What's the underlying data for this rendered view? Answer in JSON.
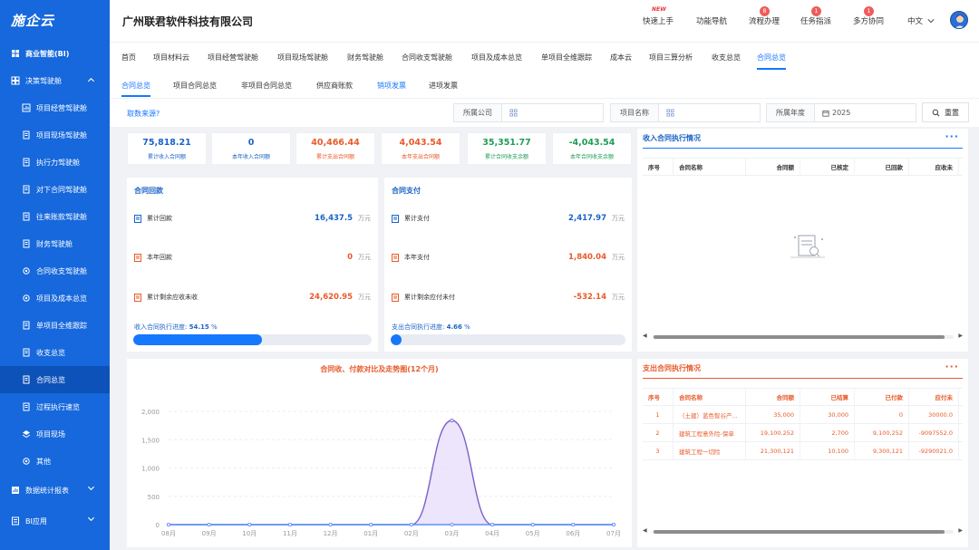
{
  "brand": {
    "logo": "施企云"
  },
  "sidebar": {
    "top": {
      "label": "商业智能(BI)",
      "icon": "grid-icon"
    },
    "group": {
      "label": "决策驾驶舱",
      "icon": "dashboard-icon"
    },
    "items": [
      {
        "label": "项目经营驾驶舱",
        "icon": "chart-icon"
      },
      {
        "label": "项目现场驾驶舱",
        "icon": "document-icon"
      },
      {
        "label": "执行力驾驶舱",
        "icon": "document-icon"
      },
      {
        "label": "对下合同驾驶舱",
        "icon": "document-icon"
      },
      {
        "label": "往来账款驾驶舱",
        "icon": "document-icon"
      },
      {
        "label": "财务驾驶舱",
        "icon": "document-icon"
      },
      {
        "label": "合同收支驾驶舱",
        "icon": "gear-icon"
      },
      {
        "label": "项目及成本总览",
        "icon": "gear-icon"
      },
      {
        "label": "单项目全维跟踪",
        "icon": "document-icon"
      },
      {
        "label": "收支总览",
        "icon": "document-icon"
      },
      {
        "label": "合同总览",
        "icon": "document-icon"
      },
      {
        "label": "过程执行速览",
        "icon": "document-icon"
      },
      {
        "label": "项目现场",
        "icon": "layers-icon"
      },
      {
        "label": "其他",
        "icon": "gear-icon"
      }
    ],
    "bottom": [
      {
        "label": "数据统计报表",
        "icon": "report-icon"
      },
      {
        "label": "BI应用",
        "icon": "app-icon"
      }
    ],
    "active_index": 10
  },
  "header": {
    "company": "广州联君软件科技有限公司",
    "nav": [
      {
        "label": "快速上手",
        "badge": "",
        "new": "NEW"
      },
      {
        "label": "功能导航",
        "badge": "",
        "new": ""
      },
      {
        "label": "流程办理",
        "badge": "8",
        "new": ""
      },
      {
        "label": "任务指派",
        "badge": "1",
        "new": ""
      },
      {
        "label": "多方协同",
        "badge": "1",
        "new": ""
      }
    ],
    "lang": "中文"
  },
  "tabs1": [
    "首页",
    "项目材料云",
    "项目经营驾驶舱",
    "项目现场驾驶舱",
    "财务驾驶舱",
    "合同收支驾驶舱",
    "项目及成本总览",
    "单项目全维跟踪",
    "成本云",
    "项目三算分析",
    "收支总览",
    "合同总览"
  ],
  "tabs1_active": 11,
  "tabs2": [
    "合同总览",
    "项目合同总览",
    "非项目合同总览",
    "供应商账款",
    "销项发票",
    "进项发票"
  ],
  "tabs2_active": 0,
  "filters": {
    "source_link": "取数来源?",
    "company_label": "所属公司",
    "project_label": "项目名称",
    "year_label": "所属年度",
    "year_value": "2025",
    "reset": "重置"
  },
  "kpis": [
    {
      "value": "75,818.21",
      "label": "累计收入合同额",
      "color": "#1a63c7"
    },
    {
      "value": "0",
      "label": "本年收入合同额",
      "color": "#1a63c7"
    },
    {
      "value": "40,466.44",
      "label": "累计支出合同额",
      "color": "#e85a2a"
    },
    {
      "value": "4,043.54",
      "label": "本年支出合同额",
      "color": "#e85a2a"
    },
    {
      "value": "35,351.77",
      "label": "累计合同收支余额",
      "color": "#1f9d55"
    },
    {
      "value": "-4,043.54",
      "label": "本年合同收支余额",
      "color": "#1f9d55"
    }
  ],
  "receivable": {
    "title": "合同回款",
    "rows": [
      {
        "label": "累计回款",
        "value": "16,437.5",
        "unit": "万元",
        "color": "#1a63c7"
      },
      {
        "label": "本年回款",
        "value": "0",
        "unit": "万元",
        "color": "#e85a2a"
      },
      {
        "label": "累计剩余应收未收",
        "value": "24,620.95",
        "unit": "万元",
        "color": "#e85a2a"
      }
    ],
    "progress_label": "收入合同执行进度:",
    "progress_value": "54.15",
    "progress_unit": "%",
    "progress": 0.5415
  },
  "payment": {
    "title": "合同支付",
    "rows": [
      {
        "label": "累计支付",
        "value": "2,417.97",
        "unit": "万元",
        "color": "#1a63c7"
      },
      {
        "label": "本年支付",
        "value": "1,840.04",
        "unit": "万元",
        "color": "#e85a2a"
      },
      {
        "label": "累计剩余应付未付",
        "value": "-532.14",
        "unit": "万元",
        "color": "#e85a2a"
      }
    ],
    "progress_label": "支出合同执行进度:",
    "progress_value": "4.66",
    "progress_unit": "%",
    "progress": 0.0466
  },
  "income_table": {
    "title": "收入合同执行情况",
    "columns": [
      "序号",
      "合同名称",
      "合同额",
      "已核定",
      "已回款",
      "应收未"
    ],
    "rows": []
  },
  "expense_table": {
    "title": "支出合同执行情况",
    "columns": [
      "序号",
      "合同名称",
      "合同额",
      "已结算",
      "已付款",
      "应付未"
    ],
    "rows": [
      [
        "1",
        "（土建）蓝色智谷产...",
        "35,000",
        "30,000",
        "0",
        "30000.0"
      ],
      [
        "2",
        "建筑工程意外险-保单",
        "19,100.252",
        "2,700",
        "9,100,252",
        "-9097552.0"
      ],
      [
        "3",
        "建筑工程一切险",
        "21,300,121",
        "10,100",
        "9,300,121",
        "-9290021.0"
      ]
    ]
  },
  "chart_data": {
    "type": "area",
    "title": "合同收、付款对比及走势图(12个月)",
    "categories": [
      "08月",
      "09月",
      "10月",
      "11月",
      "12月",
      "01月",
      "02月",
      "03月",
      "04月",
      "05月",
      "06月",
      "07月"
    ],
    "yticks": [
      0,
      500,
      1000,
      1500,
      2000
    ],
    "ylim": [
      0,
      2000
    ],
    "series": [
      {
        "values": [
          0,
          0,
          0,
          0,
          0,
          0,
          0,
          1840.04,
          0,
          0,
          0,
          0
        ],
        "color": "#7b5fc9"
      },
      {
        "values": [
          0,
          0,
          0,
          0,
          0,
          0,
          0,
          0,
          0,
          0,
          0,
          0
        ],
        "color": "#5b8ff9"
      }
    ]
  }
}
